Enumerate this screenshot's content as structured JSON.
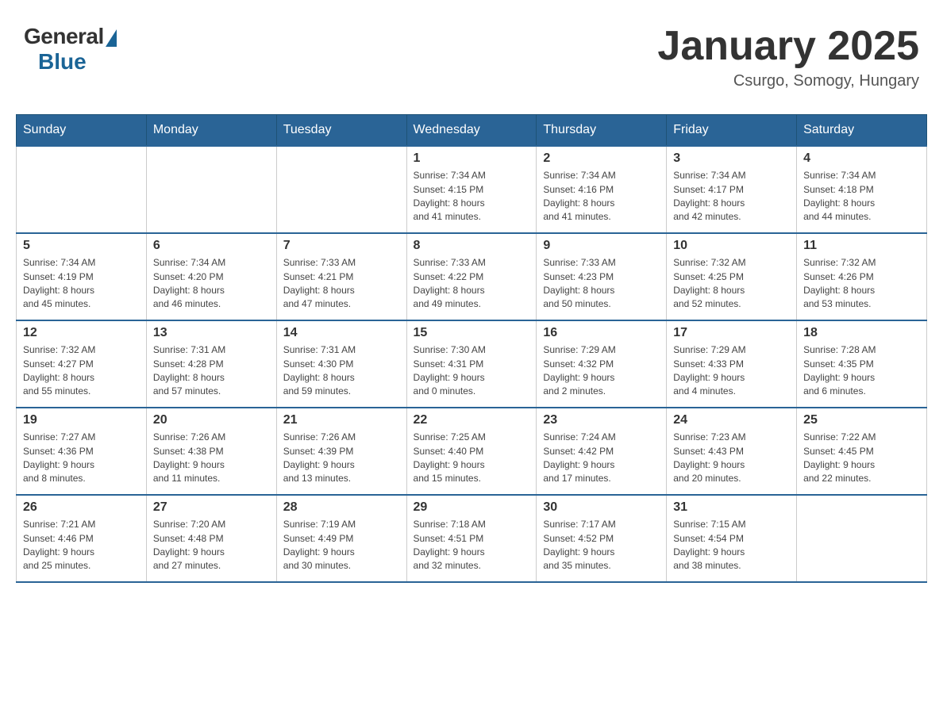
{
  "header": {
    "logo_general": "General",
    "logo_blue": "Blue",
    "month_title": "January 2025",
    "location": "Csurgo, Somogy, Hungary"
  },
  "weekdays": [
    "Sunday",
    "Monday",
    "Tuesday",
    "Wednesday",
    "Thursday",
    "Friday",
    "Saturday"
  ],
  "weeks": [
    [
      {
        "day": "",
        "info": ""
      },
      {
        "day": "",
        "info": ""
      },
      {
        "day": "",
        "info": ""
      },
      {
        "day": "1",
        "info": "Sunrise: 7:34 AM\nSunset: 4:15 PM\nDaylight: 8 hours\nand 41 minutes."
      },
      {
        "day": "2",
        "info": "Sunrise: 7:34 AM\nSunset: 4:16 PM\nDaylight: 8 hours\nand 41 minutes."
      },
      {
        "day": "3",
        "info": "Sunrise: 7:34 AM\nSunset: 4:17 PM\nDaylight: 8 hours\nand 42 minutes."
      },
      {
        "day": "4",
        "info": "Sunrise: 7:34 AM\nSunset: 4:18 PM\nDaylight: 8 hours\nand 44 minutes."
      }
    ],
    [
      {
        "day": "5",
        "info": "Sunrise: 7:34 AM\nSunset: 4:19 PM\nDaylight: 8 hours\nand 45 minutes."
      },
      {
        "day": "6",
        "info": "Sunrise: 7:34 AM\nSunset: 4:20 PM\nDaylight: 8 hours\nand 46 minutes."
      },
      {
        "day": "7",
        "info": "Sunrise: 7:33 AM\nSunset: 4:21 PM\nDaylight: 8 hours\nand 47 minutes."
      },
      {
        "day": "8",
        "info": "Sunrise: 7:33 AM\nSunset: 4:22 PM\nDaylight: 8 hours\nand 49 minutes."
      },
      {
        "day": "9",
        "info": "Sunrise: 7:33 AM\nSunset: 4:23 PM\nDaylight: 8 hours\nand 50 minutes."
      },
      {
        "day": "10",
        "info": "Sunrise: 7:32 AM\nSunset: 4:25 PM\nDaylight: 8 hours\nand 52 minutes."
      },
      {
        "day": "11",
        "info": "Sunrise: 7:32 AM\nSunset: 4:26 PM\nDaylight: 8 hours\nand 53 minutes."
      }
    ],
    [
      {
        "day": "12",
        "info": "Sunrise: 7:32 AM\nSunset: 4:27 PM\nDaylight: 8 hours\nand 55 minutes."
      },
      {
        "day": "13",
        "info": "Sunrise: 7:31 AM\nSunset: 4:28 PM\nDaylight: 8 hours\nand 57 minutes."
      },
      {
        "day": "14",
        "info": "Sunrise: 7:31 AM\nSunset: 4:30 PM\nDaylight: 8 hours\nand 59 minutes."
      },
      {
        "day": "15",
        "info": "Sunrise: 7:30 AM\nSunset: 4:31 PM\nDaylight: 9 hours\nand 0 minutes."
      },
      {
        "day": "16",
        "info": "Sunrise: 7:29 AM\nSunset: 4:32 PM\nDaylight: 9 hours\nand 2 minutes."
      },
      {
        "day": "17",
        "info": "Sunrise: 7:29 AM\nSunset: 4:33 PM\nDaylight: 9 hours\nand 4 minutes."
      },
      {
        "day": "18",
        "info": "Sunrise: 7:28 AM\nSunset: 4:35 PM\nDaylight: 9 hours\nand 6 minutes."
      }
    ],
    [
      {
        "day": "19",
        "info": "Sunrise: 7:27 AM\nSunset: 4:36 PM\nDaylight: 9 hours\nand 8 minutes."
      },
      {
        "day": "20",
        "info": "Sunrise: 7:26 AM\nSunset: 4:38 PM\nDaylight: 9 hours\nand 11 minutes."
      },
      {
        "day": "21",
        "info": "Sunrise: 7:26 AM\nSunset: 4:39 PM\nDaylight: 9 hours\nand 13 minutes."
      },
      {
        "day": "22",
        "info": "Sunrise: 7:25 AM\nSunset: 4:40 PM\nDaylight: 9 hours\nand 15 minutes."
      },
      {
        "day": "23",
        "info": "Sunrise: 7:24 AM\nSunset: 4:42 PM\nDaylight: 9 hours\nand 17 minutes."
      },
      {
        "day": "24",
        "info": "Sunrise: 7:23 AM\nSunset: 4:43 PM\nDaylight: 9 hours\nand 20 minutes."
      },
      {
        "day": "25",
        "info": "Sunrise: 7:22 AM\nSunset: 4:45 PM\nDaylight: 9 hours\nand 22 minutes."
      }
    ],
    [
      {
        "day": "26",
        "info": "Sunrise: 7:21 AM\nSunset: 4:46 PM\nDaylight: 9 hours\nand 25 minutes."
      },
      {
        "day": "27",
        "info": "Sunrise: 7:20 AM\nSunset: 4:48 PM\nDaylight: 9 hours\nand 27 minutes."
      },
      {
        "day": "28",
        "info": "Sunrise: 7:19 AM\nSunset: 4:49 PM\nDaylight: 9 hours\nand 30 minutes."
      },
      {
        "day": "29",
        "info": "Sunrise: 7:18 AM\nSunset: 4:51 PM\nDaylight: 9 hours\nand 32 minutes."
      },
      {
        "day": "30",
        "info": "Sunrise: 7:17 AM\nSunset: 4:52 PM\nDaylight: 9 hours\nand 35 minutes."
      },
      {
        "day": "31",
        "info": "Sunrise: 7:15 AM\nSunset: 4:54 PM\nDaylight: 9 hours\nand 38 minutes."
      },
      {
        "day": "",
        "info": ""
      }
    ]
  ]
}
